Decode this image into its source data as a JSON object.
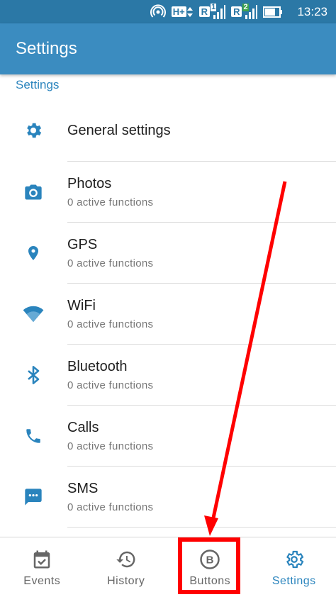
{
  "status_bar": {
    "time": "13:23",
    "network_label": "H+",
    "sim1_label": "R",
    "sim1_index": "1",
    "sim2_label": "R",
    "sim2_index": "2",
    "icons": [
      "hotspot-icon",
      "signal-icon",
      "battery-icon"
    ]
  },
  "app_bar": {
    "title": "Settings"
  },
  "section": {
    "header": "Settings"
  },
  "list": {
    "items": [
      {
        "label": "General settings",
        "icon": "gear-icon"
      },
      {
        "label": "Photos",
        "sub": "0 active functions",
        "icon": "camera-icon"
      },
      {
        "label": "GPS",
        "sub": "0 active functions",
        "icon": "location-pin-icon"
      },
      {
        "label": "WiFi",
        "sub": "0 active functions",
        "icon": "wifi-icon"
      },
      {
        "label": "Bluetooth",
        "sub": "0 active functions",
        "icon": "bluetooth-icon"
      },
      {
        "label": "Calls",
        "sub": "0 active functions",
        "icon": "phone-icon"
      },
      {
        "label": "SMS",
        "sub": "0 active functions",
        "icon": "sms-icon"
      }
    ]
  },
  "bottom_nav": {
    "items": [
      {
        "label": "Events",
        "icon": "calendar-check-icon"
      },
      {
        "label": "History",
        "icon": "history-icon"
      },
      {
        "label": "Buttons",
        "icon": "button-b-icon",
        "glyph": "B"
      },
      {
        "label": "Settings",
        "icon": "gear-icon",
        "active": true
      }
    ]
  },
  "colors": {
    "status_bar": "#2b78a6",
    "app_bar": "#3b8cc0",
    "accent": "#2a84bd",
    "annotation": "#ff0000",
    "nav_inactive": "#666666"
  }
}
